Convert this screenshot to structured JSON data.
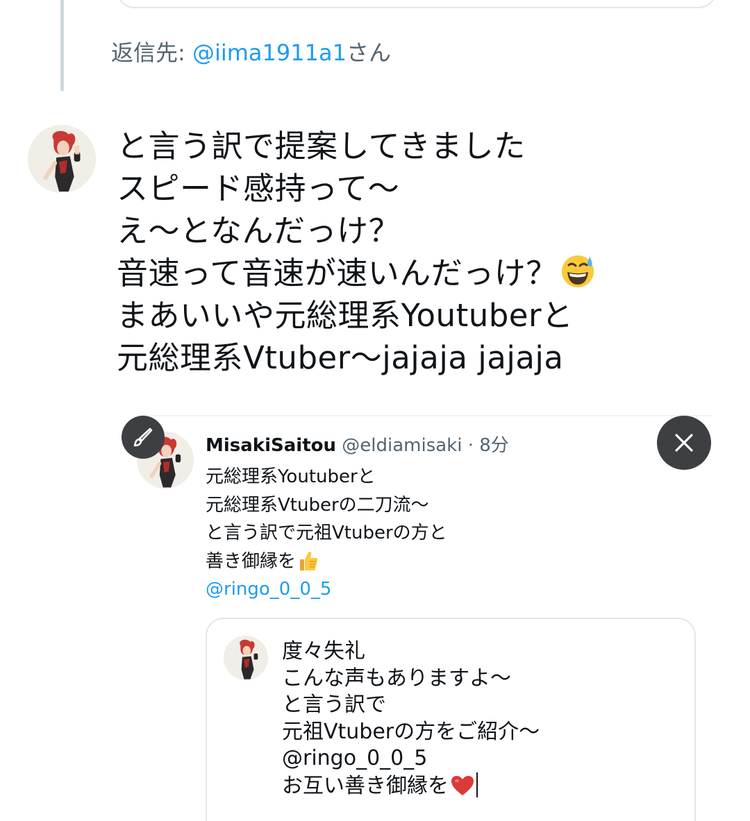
{
  "reply_to": {
    "prefix": "返信先: ",
    "handle": "@iima1911a1",
    "suffix": "さん"
  },
  "compose": {
    "lines": [
      "と言う訳で提案してきました",
      "スピード感持って〜",
      "え〜となんだっけ？",
      "音速って音速が速いんだっけ？",
      "まあいいや元総理系Youtuberと",
      "元総理系Vtuber〜jajaja jajaja"
    ],
    "line4_emoji": "grinning-face-with-sweat-icon"
  },
  "quote": {
    "author_name": "MisakiSaitou",
    "author_handle": "@eldiamisaki",
    "separator": " · ",
    "time": "8分",
    "lines": [
      "元総理系Youtuberと",
      "元総理系Vtuberの二刀流〜",
      "と言う訳で元祖Vtuberの方と",
      "善き御縁を"
    ],
    "line4_emoji": "thumbs-up-icon",
    "mention": "@ringo_0_0_5"
  },
  "inner_quote": {
    "lines": [
      "度々失礼",
      "こんな声もありますよ〜",
      "と言う訳で",
      "元祖Vtuberの方をご紹介〜",
      "@ringo_0_0_5",
      "お互い善き御縁を"
    ],
    "last_emoji": "red-heart-icon"
  },
  "icons": {
    "edit": "paintbrush-icon",
    "close": "close-icon"
  },
  "colors": {
    "link": "#1d9bf0",
    "muted": "#536471",
    "text": "#0f1419",
    "overlay_button": "#3d3f42"
  }
}
